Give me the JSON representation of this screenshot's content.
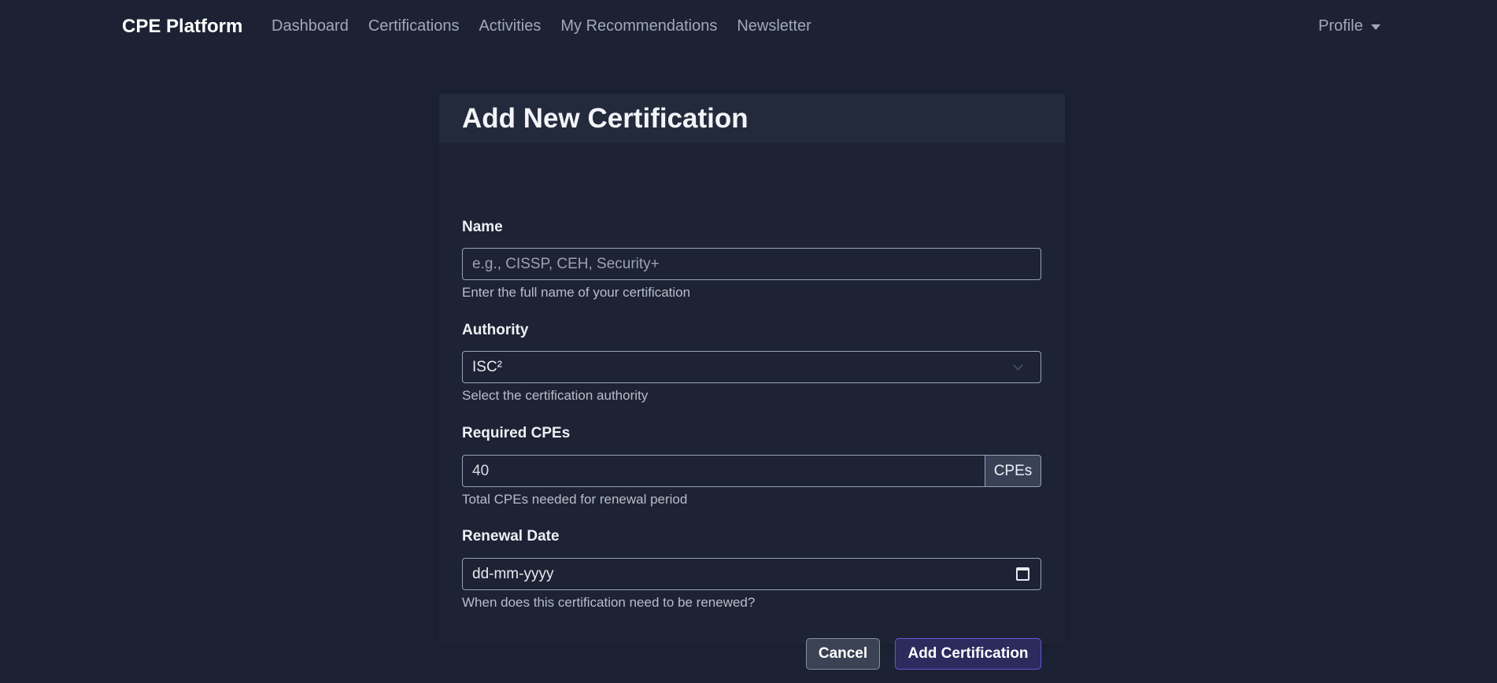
{
  "navbar": {
    "brand": "CPE Platform",
    "links": [
      "Dashboard",
      "Certifications",
      "Activities",
      "My Recommendations",
      "Newsletter"
    ],
    "profile": "Profile"
  },
  "form": {
    "title": "Add New Certification",
    "name": {
      "label": "Name",
      "placeholder": "e.g., CISSP, CEH, Security+",
      "value": "",
      "help": "Enter the full name of your certification"
    },
    "authority": {
      "label": "Authority",
      "selected": "ISC²",
      "help": "Select the certification authority"
    },
    "required_cpes": {
      "label": "Required CPEs",
      "value": "40",
      "addon": "CPEs",
      "help": "Total CPEs needed for renewal period"
    },
    "renewal_date": {
      "label": "Renewal Date",
      "placeholder": "dd-mm-yyyy",
      "help": "When does this certification need to be renewed?"
    },
    "buttons": {
      "cancel": "Cancel",
      "submit": "Add Certification"
    }
  },
  "colors": {
    "background": "#1c2233",
    "card_header": "#232a3c",
    "primary_button": "#2d2a5e",
    "primary_border": "#6258d8"
  }
}
